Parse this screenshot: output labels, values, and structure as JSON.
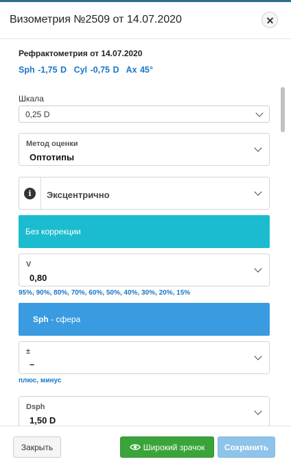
{
  "dialog": {
    "title": "Визометрия №2509 от 14.07.2020"
  },
  "refraction": {
    "title": "Рефрактометрия от 14.07.2020",
    "sph": "Sph -1,75 D",
    "cyl": "Cyl -0,75 D",
    "ax": "Ax 45°"
  },
  "scale": {
    "label": "Шкала",
    "value": "0,25 D"
  },
  "method": {
    "label": "Метод оценки",
    "value": "Оптотипы"
  },
  "eccentric": {
    "value": "Эксцентрично"
  },
  "no_correction": {
    "label": "Без коррекции"
  },
  "v_field": {
    "label": "V",
    "value": "0,80",
    "hint": "95%, 90%, 80%, 70%, 60%, 50%, 40%, 30%, 20%, 15%"
  },
  "sph_banner": {
    "bold": "Sph",
    "rest": " - сфера"
  },
  "sign_field": {
    "label": "±",
    "value": "–",
    "hint": "плюс, минус"
  },
  "dsph_field": {
    "label": "Dsph",
    "value": "1,50 D"
  },
  "footer": {
    "close_label": "Закрыть",
    "wide_pupil_label": "Широкий зрачок",
    "save_label": "Сохранить"
  },
  "colors": {
    "accent_link": "#1976c8",
    "teal_banner": "#1bbccf",
    "blue_banner": "#3a9be0",
    "green_button": "#3aa43a",
    "save_button_disabled": "#8ec3ea"
  },
  "icons": {
    "close": "close-icon",
    "info": "info-icon",
    "chevron": "chevron-down-icon",
    "eye": "eye-icon"
  }
}
